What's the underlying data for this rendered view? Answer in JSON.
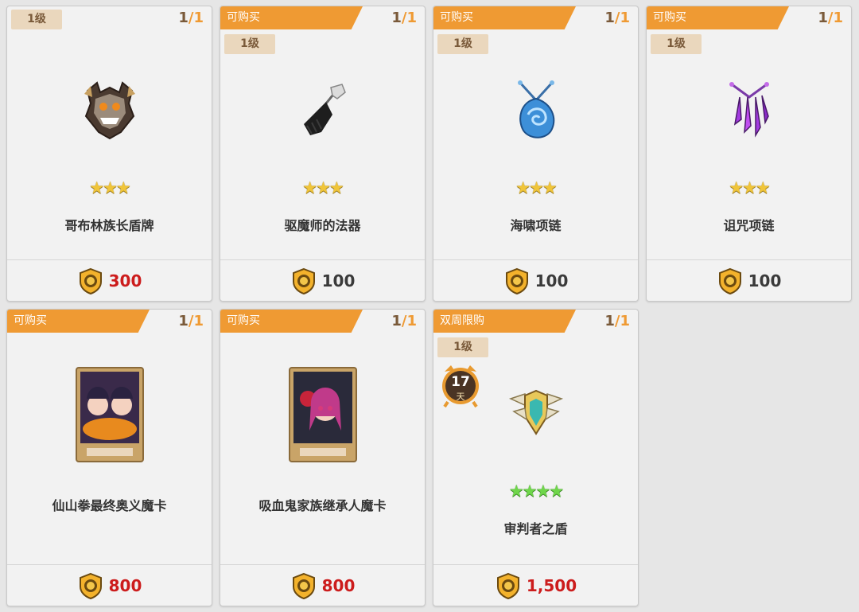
{
  "cards": [
    {
      "banner": "",
      "count": {
        "cur": "1",
        "total": "1"
      },
      "level": "1级",
      "icon": "goblin-shield-icon",
      "stars": "★★★",
      "name": "哥布林族长盾牌",
      "price": "300",
      "price_color": "#cc1c1c"
    },
    {
      "banner": "可购买",
      "count": {
        "cur": "1",
        "total": "1"
      },
      "level": "1级",
      "icon": "black-tassel-icon",
      "stars": "★★★",
      "name": "驱魔师的法器",
      "price": "100",
      "price_color": "#3a3a3a"
    },
    {
      "banner": "可购买",
      "count": {
        "cur": "1",
        "total": "1"
      },
      "level": "1级",
      "icon": "blue-shell-necklace-icon",
      "stars": "★★★",
      "name": "海啸项链",
      "price": "100",
      "price_color": "#3a3a3a"
    },
    {
      "banner": "可购买",
      "count": {
        "cur": "1",
        "total": "1"
      },
      "level": "1级",
      "icon": "purple-claw-necklace-icon",
      "stars": "★★★",
      "name": "诅咒项链",
      "price": "100",
      "price_color": "#3a3a3a"
    },
    {
      "banner": "可购买",
      "count": {
        "cur": "1",
        "total": "1"
      },
      "icon": "twin-fighters-card-icon",
      "name": "仙山拳最终奥义魔卡",
      "price": "800",
      "price_color": "#cc1c1c"
    },
    {
      "banner": "可购买",
      "count": {
        "cur": "1",
        "total": "1"
      },
      "icon": "vampire-heir-card-icon",
      "name": "吸血鬼家族继承人魔卡",
      "price": "800",
      "price_color": "#cc1c1c"
    },
    {
      "banner": "双周限购",
      "count": {
        "cur": "1",
        "total": "1"
      },
      "level": "1级",
      "timer": {
        "num": "17",
        "unit": "天"
      },
      "icon": "winged-crest-icon",
      "stars": "★★★★",
      "name": "审判者之盾",
      "price": "1,500",
      "price_color": "#cc1c1c"
    }
  ]
}
